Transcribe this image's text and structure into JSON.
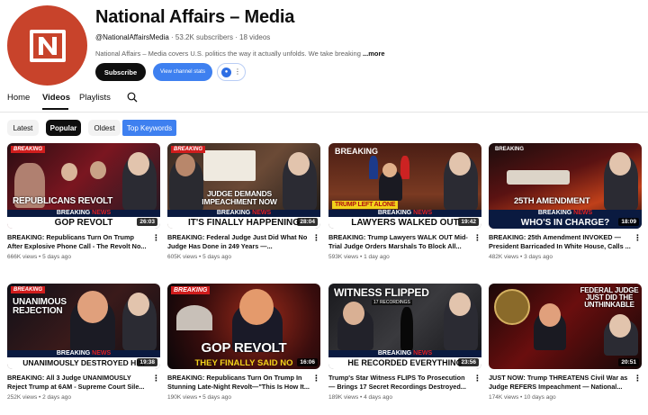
{
  "channel": {
    "name": "National Affairs – Media",
    "handle": "@NationalAffairsMedia",
    "stats": "· 53.2K subscribers · 18 videos",
    "description": "National Affairs – Media covers U.S. politics the way it actually unfolds. We take breaking",
    "more_label": "...more",
    "subscribe_label": "Subscribe",
    "stats_button_label": "View channel stats",
    "brand_color": "#c8432b"
  },
  "tabs": [
    {
      "label": "Home"
    },
    {
      "label": "Videos"
    },
    {
      "label": "Playlists"
    }
  ],
  "filters": {
    "latest": "Latest",
    "popular": "Popular",
    "oldest": "Oldest",
    "keywords": "Top Keywords"
  },
  "videos": [
    {
      "title": "BREAKING: Republicans Turn On Trump After Explosive Phone Call - The Revolt No...",
      "views": "666K views",
      "age": "5 days ago",
      "duration": "26:03",
      "thumb": {
        "tag": "BREAKING",
        "headline": "REPUBLICANS REVOLT",
        "band_top": "BREAKING NEWS",
        "band": "GOP REVOLT"
      }
    },
    {
      "title": "BREAKING: Federal Judge Just Did What No Judge Has Done in 249 Years —...",
      "views": "605K views",
      "age": "5 days ago",
      "duration": "28:04",
      "thumb": {
        "tag": "BREAKING",
        "headline": "JUDGE DEMANDS IMPEACHMENT NOW",
        "band_top": "BREAKING NEWS",
        "band": "IT'S FINALLY HAPPENING"
      }
    },
    {
      "title": "BREAKING: Trump Lawyers WALK OUT Mid-Trial Judge Orders Marshals To Block All...",
      "views": "593K views",
      "age": "1 day ago",
      "duration": "19:42",
      "thumb": {
        "tag": "BREAKING",
        "headline": "TRUMP LEFT ALONE",
        "band_top": "BREAKING NEWS",
        "band": "LAWYERS WALKED OUT"
      }
    },
    {
      "title": "BREAKING: 25th Amendment INVOKED — President Barricaded In White House, Calls ...",
      "views": "482K views",
      "age": "3 days ago",
      "duration": "18:09",
      "thumb": {
        "tag": "BREAKING",
        "headline": "25TH AMENDMENT",
        "band_top": "BREAKING NEWS",
        "band": "WHO'S IN CHARGE?"
      }
    },
    {
      "title": "BREAKING: All 3 Judge UNANIMOUSLY Reject Trump at 6AM - Supreme Court Sile...",
      "views": "252K views",
      "age": "2 days ago",
      "duration": "19:38",
      "thumb": {
        "tag": "BREAKING",
        "headline": "UNANIMOUS REJECTION",
        "band_top": "BREAKING NEWS",
        "band": "UNANIMOUSLY DESTROYED HIM"
      }
    },
    {
      "title": "BREAKING: Republicans Turn On Trump In Stunning Late-Night Revolt—\"This Is How It...",
      "views": "190K views",
      "age": "5 days ago",
      "duration": "16:06",
      "thumb": {
        "tag": "BREAKING",
        "headline": "GOP REVOLT",
        "band_top": "",
        "band": "THEY FINALLY SAID NO"
      }
    },
    {
      "title": "Trump's Star Witness FLIPS To Prosecution — Brings 17 Secret Recordings Destroyed...",
      "views": "189K views",
      "age": "4 days ago",
      "duration": "23:56",
      "thumb": {
        "tag": "",
        "headline": "WITNESS FLIPPED",
        "band_top": "BREAKING NEWS",
        "band": "HE RECORDED EVERYTHING"
      }
    },
    {
      "title": "JUST NOW: Trump THREATENS Civil War as Judge REFERS Impeachment — National...",
      "views": "174K views",
      "age": "10 days ago",
      "duration": "20:51",
      "thumb": {
        "tag": "",
        "headline": "FEDERAL JUDGE JUST DID THE UNTHINKABLE",
        "band_top": "",
        "band": ""
      }
    }
  ]
}
